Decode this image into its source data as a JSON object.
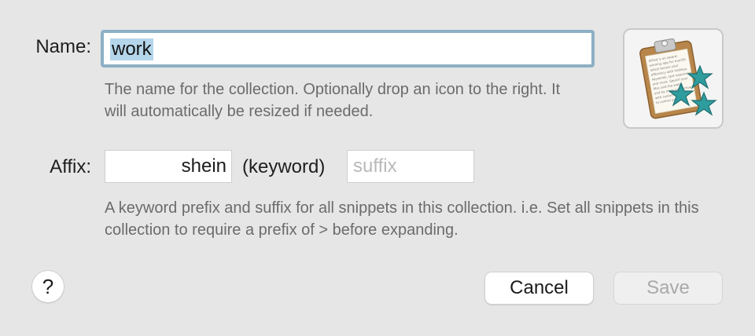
{
  "form": {
    "name_label": "Name:",
    "name_value": "work",
    "name_help": "The name for the collection. Optionally drop an icon to the right. It will automatically be resized if needed.",
    "affix_label": "Affix:",
    "prefix_value": "shein",
    "keyword_text": "(keyword)",
    "suffix_placeholder": "suffix",
    "affix_help": "A keyword prefix and suffix for all snippets in this collection. i.e. Set all snippets in this collection to require a prefix of > before expanding."
  },
  "icon": {
    "name": "clipboard-stars-icon",
    "colors": {
      "clipboard": "#b8864a",
      "paper": "#fbf8ef",
      "star": "#2f9c9e"
    },
    "page_lines": [
      "Alfred is an award-",
      "winning app for macOS",
      "which boosts your",
      "efficiency with hotkeys,",
      "keywords, text expansion",
      "and more. Search your",
      "Mac and the web,",
      "and be more productive",
      "with custom actions",
      "to control your Mac."
    ]
  },
  "footer": {
    "help_label": "?",
    "cancel_label": "Cancel",
    "save_label": "Save"
  }
}
